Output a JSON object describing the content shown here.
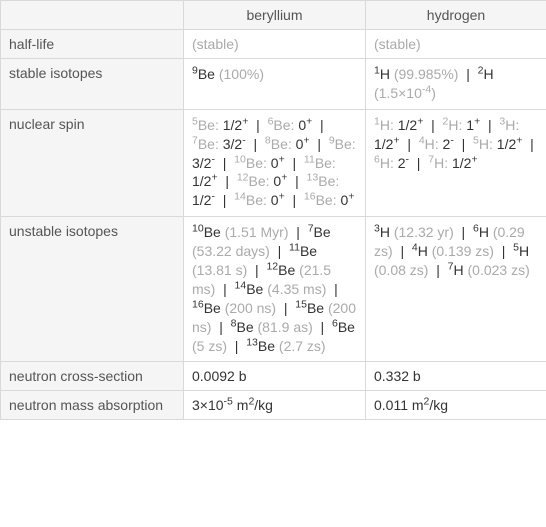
{
  "header": {
    "blank": "",
    "col1": "beryllium",
    "col2": "hydrogen"
  },
  "rows": {
    "half_life": {
      "label": "half-life",
      "be": "(stable)",
      "h": "(stable)"
    },
    "stable_isotopes": {
      "label": "stable isotopes"
    },
    "nuclear_spin": {
      "label": "nuclear spin"
    },
    "unstable_isotopes": {
      "label": "unstable isotopes"
    },
    "neutron_cs": {
      "label": "neutron cross-section",
      "be": "0.0092 b",
      "h": "0.332 b"
    },
    "neutron_ma": {
      "label": "neutron mass absorption"
    }
  },
  "chart_data": {
    "type": "table",
    "columns": [
      "property",
      "beryllium",
      "hydrogen"
    ],
    "rows": [
      {
        "property": "half-life",
        "beryllium": "(stable)",
        "hydrogen": "(stable)"
      },
      {
        "property": "stable isotopes",
        "beryllium": [
          {
            "isotope": "9Be",
            "abundance": "100%"
          }
        ],
        "hydrogen": [
          {
            "isotope": "1H",
            "abundance": "99.985%"
          },
          {
            "isotope": "2H",
            "abundance": "1.5×10^-4"
          }
        ]
      },
      {
        "property": "nuclear spin",
        "beryllium": [
          {
            "isotope": "5Be",
            "spin": "1/2+"
          },
          {
            "isotope": "6Be",
            "spin": "0+"
          },
          {
            "isotope": "7Be",
            "spin": "3/2-"
          },
          {
            "isotope": "8Be",
            "spin": "0+"
          },
          {
            "isotope": "9Be",
            "spin": "3/2-"
          },
          {
            "isotope": "10Be",
            "spin": "0+"
          },
          {
            "isotope": "11Be",
            "spin": "1/2+"
          },
          {
            "isotope": "12Be",
            "spin": "0+"
          },
          {
            "isotope": "13Be",
            "spin": "1/2-"
          },
          {
            "isotope": "14Be",
            "spin": "0+"
          },
          {
            "isotope": "16Be",
            "spin": "0+"
          }
        ],
        "hydrogen": [
          {
            "isotope": "1H",
            "spin": "1/2+"
          },
          {
            "isotope": "2H",
            "spin": "1+"
          },
          {
            "isotope": "3H",
            "spin": "1/2+"
          },
          {
            "isotope": "4H",
            "spin": "2-"
          },
          {
            "isotope": "5H",
            "spin": "1/2+"
          },
          {
            "isotope": "6H",
            "spin": "2-"
          },
          {
            "isotope": "7H",
            "spin": "1/2+"
          }
        ]
      },
      {
        "property": "unstable isotopes",
        "beryllium": [
          {
            "isotope": "10Be",
            "half_life": "1.51 Myr"
          },
          {
            "isotope": "7Be",
            "half_life": "53.22 days"
          },
          {
            "isotope": "11Be",
            "half_life": "13.81 s"
          },
          {
            "isotope": "12Be",
            "half_life": "21.5 ms"
          },
          {
            "isotope": "14Be",
            "half_life": "4.35 ms"
          },
          {
            "isotope": "16Be",
            "half_life": "200 ns"
          },
          {
            "isotope": "15Be",
            "half_life": "200 ns"
          },
          {
            "isotope": "8Be",
            "half_life": "81.9 as"
          },
          {
            "isotope": "6Be",
            "half_life": "5 zs"
          },
          {
            "isotope": "13Be",
            "half_life": "2.7 zs"
          }
        ],
        "hydrogen": [
          {
            "isotope": "3H",
            "half_life": "12.32 yr"
          },
          {
            "isotope": "6H",
            "half_life": "0.29 zs"
          },
          {
            "isotope": "4H",
            "half_life": "0.139 zs"
          },
          {
            "isotope": "5H",
            "half_life": "0.08 zs"
          },
          {
            "isotope": "7H",
            "half_life": "0.023 zs"
          }
        ]
      },
      {
        "property": "neutron cross-section",
        "beryllium": "0.0092 b",
        "hydrogen": "0.332 b"
      },
      {
        "property": "neutron mass absorption",
        "beryllium": "3×10^-5 m^2/kg",
        "hydrogen": "0.011 m^2/kg"
      }
    ]
  }
}
